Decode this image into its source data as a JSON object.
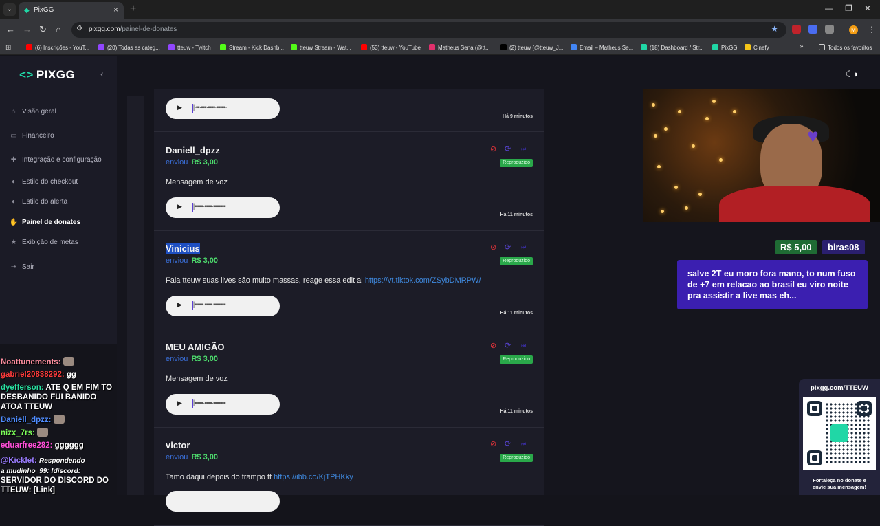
{
  "browser": {
    "tab_title": "PixGG",
    "url_host": "pixgg.com",
    "url_path": "/painel-de-donates",
    "profile_initial": "M",
    "bookmarks": [
      {
        "label": "(6) Inscrições - YouT...",
        "color": "#ff0000"
      },
      {
        "label": "(20) Todas as categ...",
        "color": "#9146ff"
      },
      {
        "label": "tteuw - Twitch",
        "color": "#9146ff"
      },
      {
        "label": "Stream - Kick Dashb...",
        "color": "#53fc18"
      },
      {
        "label": "tteuw Stream - Wat...",
        "color": "#53fc18"
      },
      {
        "label": "(53) tteuw - YouTube",
        "color": "#ff0000"
      },
      {
        "label": "Matheus Sena (@tt...",
        "color": "#e1306c"
      },
      {
        "label": "(2) tteuw (@tteuw_J...",
        "color": "#000000"
      },
      {
        "label": "Email – Matheus Se...",
        "color": "#4285f4"
      },
      {
        "label": "(18) Dashboard / Str...",
        "color": "#20d7a6"
      },
      {
        "label": "PixGG",
        "color": "#20d7a6"
      },
      {
        "label": "Cinefy",
        "color": "#f5c518"
      }
    ],
    "all_bookmarks": "Todos os favoritos"
  },
  "sidebar": {
    "brand": "PIXGG",
    "items": [
      {
        "label": "Visão geral",
        "icon": "home-icon"
      },
      {
        "label": "Financeiro",
        "icon": "wallet-icon"
      },
      {
        "label": "Integração e configuração",
        "icon": "puzzle-icon"
      },
      {
        "label": "Estilo do checkout",
        "icon": "palette-icon"
      },
      {
        "label": "Estilo do alerta",
        "icon": "palette-icon"
      },
      {
        "label": "Painel de donates",
        "icon": "hand-coins-icon"
      },
      {
        "label": "Exibição de metas",
        "icon": "star-icon"
      },
      {
        "label": "Sair",
        "icon": "logout-icon"
      }
    ]
  },
  "donates": {
    "sent_label": "enviou",
    "played_label": "Reproduzido",
    "first_time": "Há 9 minutos",
    "items": [
      {
        "name": "Daniell_dpzz",
        "amount": "R$ 3,00",
        "message": "Mensagem de voz",
        "link": "",
        "time": "Há 11 minutos"
      },
      {
        "name": "Vinicius",
        "amount": "R$ 3,00",
        "message": "Fala tteuw suas lives são muito massas, reage essa edit ai ",
        "link": "https://vt.tiktok.com/ZSybDMRPW/",
        "time": "Há 11 minutos"
      },
      {
        "name": "MEU AMIGÃO",
        "amount": "R$ 3,00",
        "message": "Mensagem de voz",
        "link": "",
        "time": "Há 11 minutos"
      },
      {
        "name": "victor",
        "amount": "R$ 3,00",
        "message": "Tamo daqui depois do trampo tt ",
        "link": "https://ibb.co/KjTPHKky",
        "time": ""
      }
    ]
  },
  "alert": {
    "amount": "R$ 5,00",
    "name": "biras08",
    "message": "salve 2T eu moro fora mano, to num fuso de +7 em relacao ao brasil eu viro noite pra assistir a live mas eh..."
  },
  "qr": {
    "url": "pixgg.com/TTEUW",
    "caption_1": "Fortaleça no donate e",
    "caption_2": "envie sua mensagem!"
  },
  "chat": [
    {
      "user": "Noattunements:",
      "text": "",
      "color": "#ff8fa0"
    },
    {
      "user": "gabriel20838292:",
      "text": "gg",
      "color": "#ff3b3b"
    },
    {
      "user": "dyefferson:",
      "text": "ATE Q EM FIM TO",
      "color": "#28e0a0"
    },
    {
      "user": "",
      "text": "DESBANIDO FUI BANIDO",
      "color": "#ffffff"
    },
    {
      "user": "",
      "text": "ATOA TTEUW",
      "color": "#ffffff"
    },
    {
      "user": "Daniell_dpzz:",
      "text": "",
      "color": "#4f8cff"
    },
    {
      "user": "nizx_7rs:",
      "text": "",
      "color": "#7dff5a"
    },
    {
      "user": "eduarfree282:",
      "text": "gggggg",
      "color": "#ff4fd8"
    },
    {
      "user": "@Kicklet:",
      "text": "Respondendo",
      "color": "#9a7cff"
    },
    {
      "user": "",
      "text": "a mudinho_99: !discord:",
      "color": "#ffffff"
    },
    {
      "user": "",
      "text": "SERVIDOR DO DISCORD DO",
      "color": "#ffffff"
    },
    {
      "user": "",
      "text": "TTEUW: [Link]",
      "color": "#ffffff"
    }
  ]
}
